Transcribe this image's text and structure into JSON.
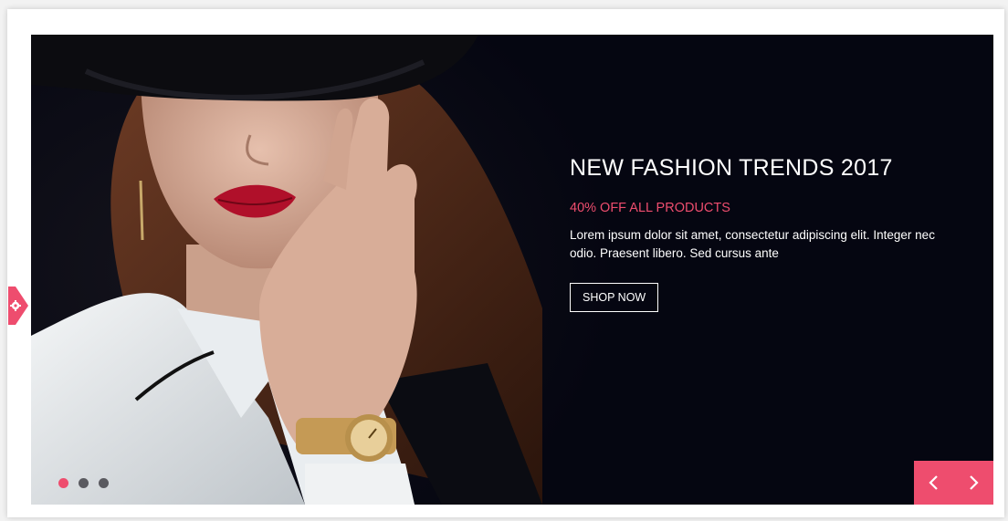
{
  "slide": {
    "title": "NEW FASHION TRENDS 2017",
    "offer": "40% OFF ALL PRODUCTS",
    "description": "Lorem ipsum dolor sit amet, consectetur adipiscing elit. Integer nec odio. Praesent libero. Sed cursus ante",
    "button_label": "SHOP NOW"
  },
  "pagination": {
    "count": 3,
    "active_index": 0
  },
  "colors": {
    "accent": "#ee4d6e",
    "slide_background": "#050611",
    "dot_inactive": "#5a5a60",
    "text": "#ffffff"
  },
  "icons": {
    "prev": "chevron-left-icon",
    "next": "chevron-right-icon",
    "settings": "gear-icon"
  }
}
